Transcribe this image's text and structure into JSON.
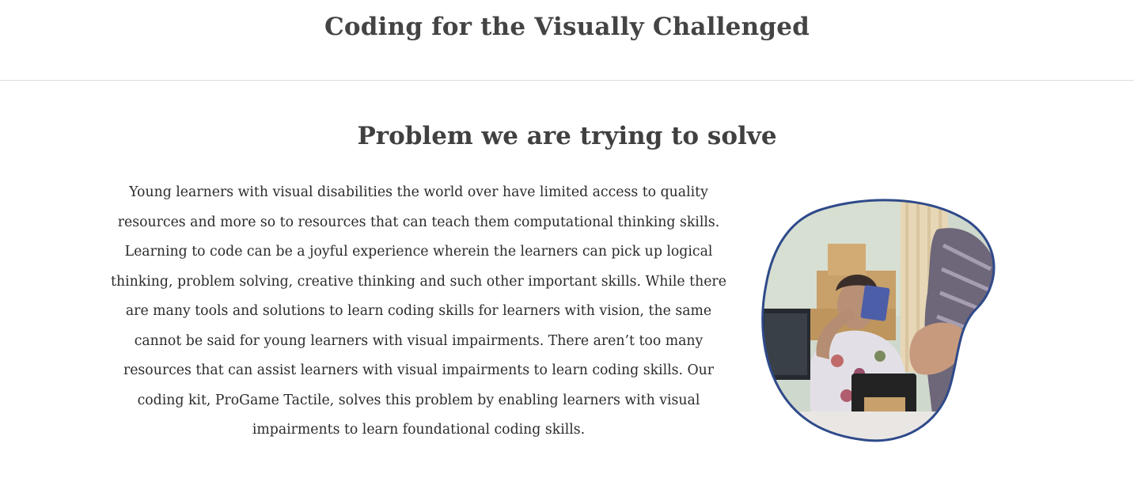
{
  "header": {
    "site_title": "Coding for the Visually Challenged"
  },
  "problem_section": {
    "heading": "Problem we are trying to solve",
    "body": "Young learners with visual disabilities the world over have limited access to quality resources and more so to resources that can teach them computational thinking skills. Learning to code can be a joyful experience wherein the learners can pick up logical thinking, problem solving, creative thinking and such other important skills. While there are many tools and solutions to learn coding skills for learners with vision, the same cannot be said for young learners with visual impairments. There aren’t too many resources that can assist learners with visual impairments to learn coding skills. Our coding kit, ProGame Tactile, solves this problem by enabling learners with visual impairments to learn foundational coding skills."
  },
  "colors": {
    "blob_border": "#2f4a8a",
    "heading_text": "#404040",
    "divider": "#dddddd"
  }
}
